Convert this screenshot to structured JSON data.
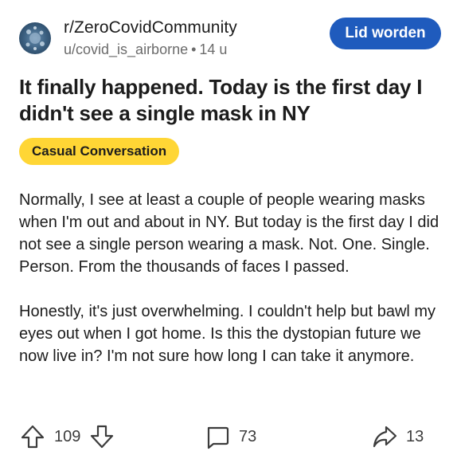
{
  "post": {
    "subreddit": "r/ZeroCovidCommunity",
    "author": "u/covid_is_airborne",
    "separator": "•",
    "age": "14 u",
    "join_label": "Lid worden",
    "title": "It finally happened. Today is the first day I didn't see a single mask in NY",
    "flair": "Casual Conversation",
    "flair_color": "#ffd635",
    "join_color": "#1f5bbd",
    "paragraphs": [
      "Normally, I see at least a couple of people wearing masks when I'm out and about in NY. But today is the first day I did not see a single person wearing a mask. Not. One. Single. Person. From the thousands of faces I passed.",
      "Honestly, it's just overwhelming. I couldn't help but bawl my eyes out when I got home. Is this the dystopian future we now live in? I'm not sure how long I can take it anymore."
    ]
  },
  "actions": {
    "vote_count": "109",
    "comment_count": "73",
    "share_count": "13",
    "icons": [
      "upvote-icon",
      "downvote-icon",
      "comment-icon",
      "share-icon"
    ]
  }
}
